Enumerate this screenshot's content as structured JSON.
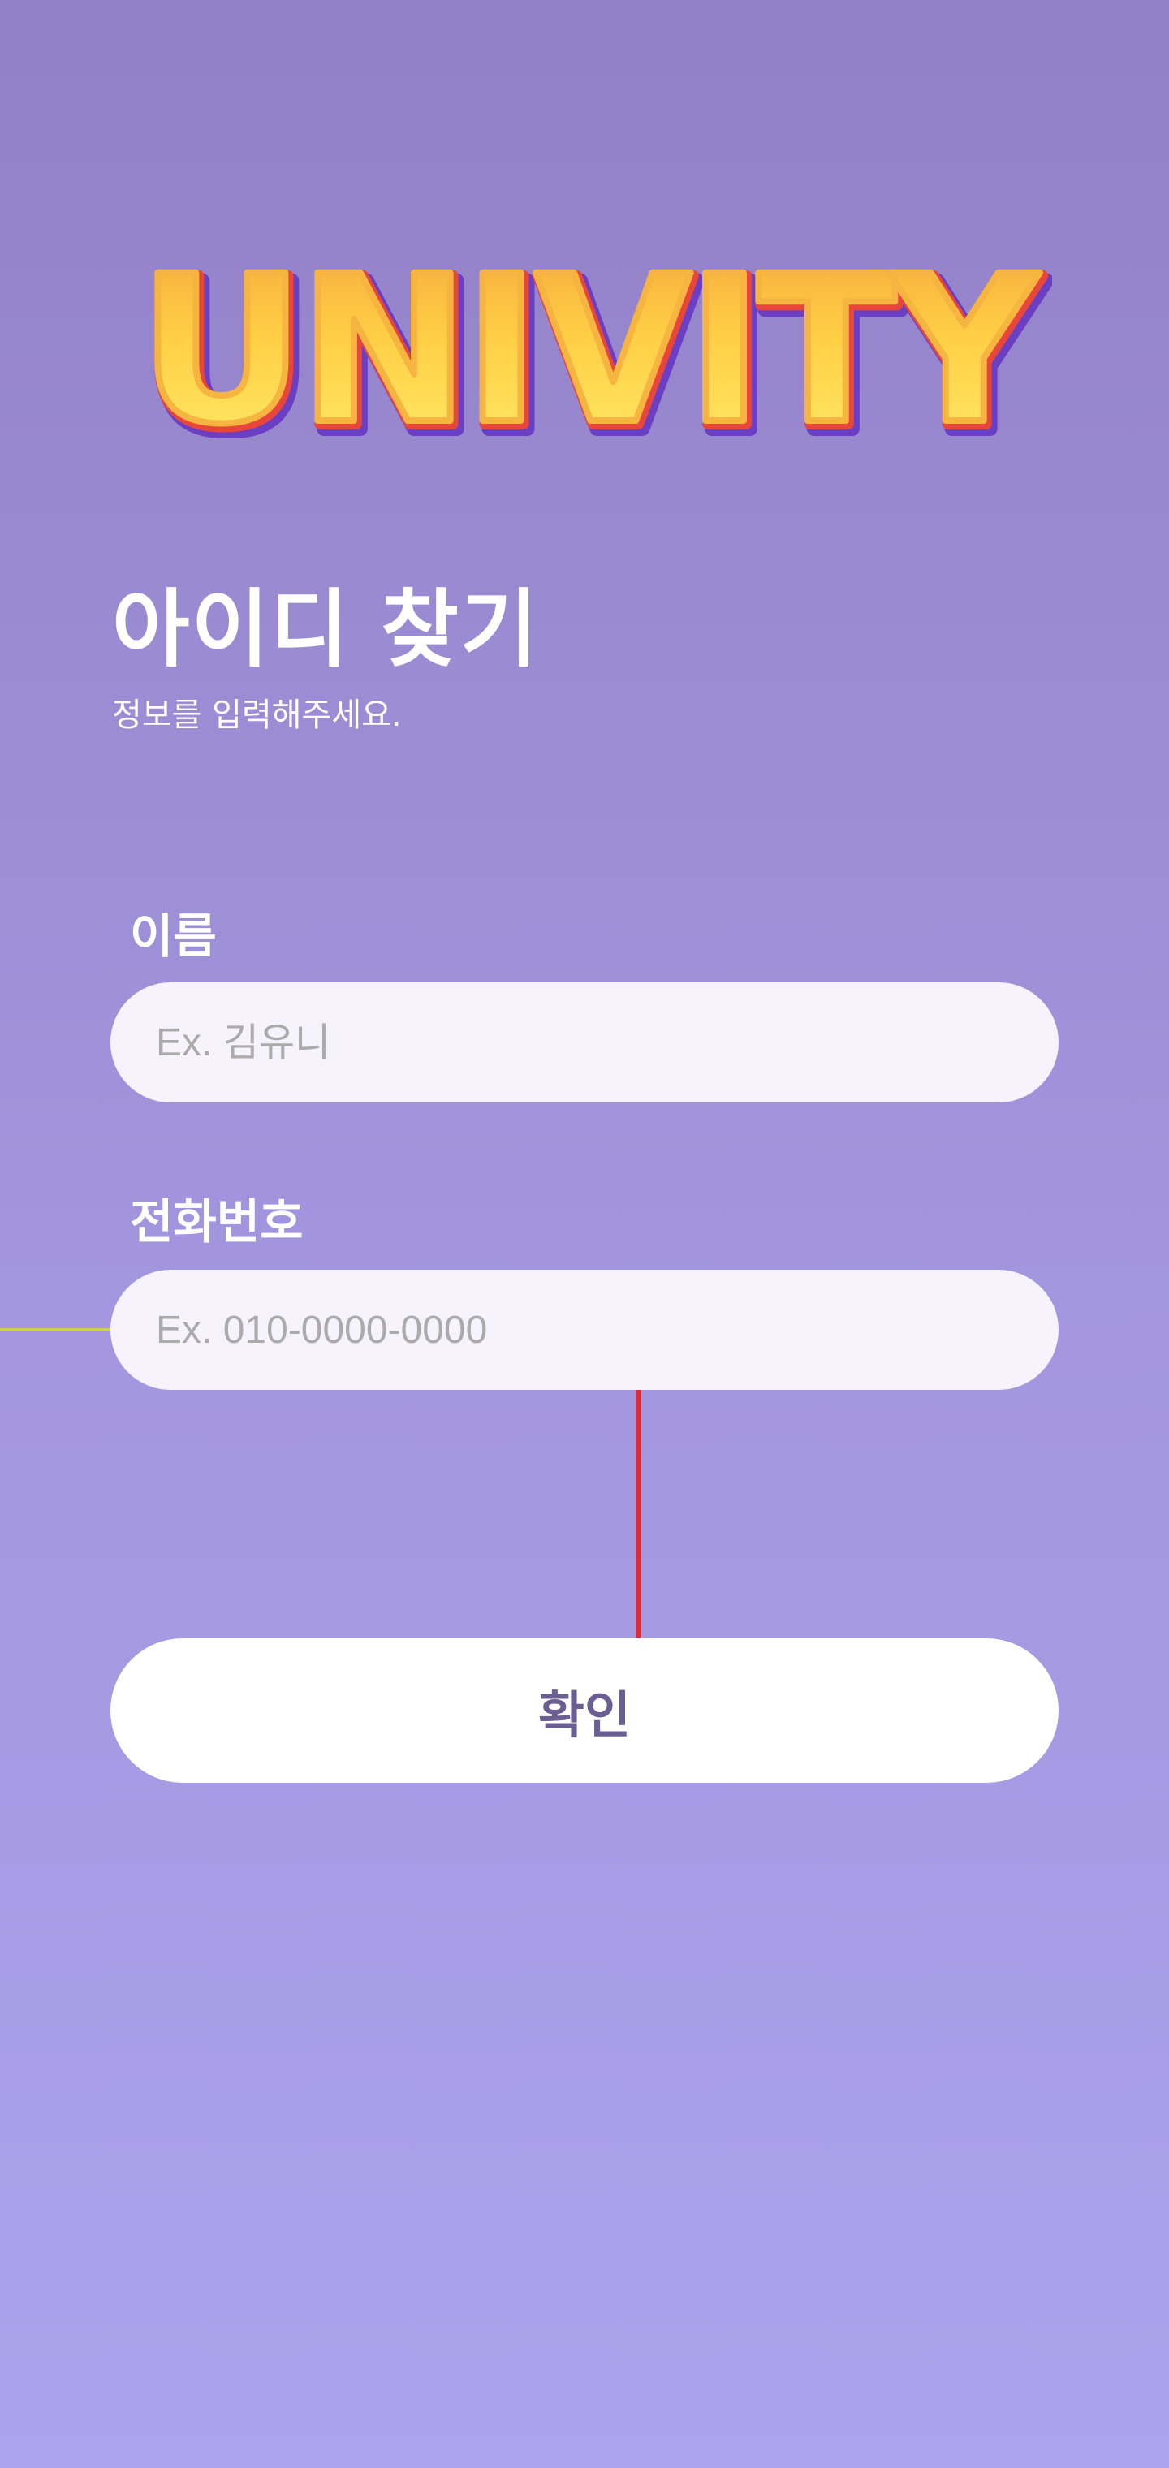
{
  "app": {
    "logo_text": "UNIVITY"
  },
  "header": {
    "title": "아이디 찾기",
    "subtitle": "정보를 입력해주세요."
  },
  "form": {
    "name": {
      "label": "이름",
      "placeholder": "Ex. 김유니",
      "value": ""
    },
    "phone": {
      "label": "전화번호",
      "placeholder": "Ex. 010-0000-0000",
      "value": ""
    },
    "confirm_label": "확인"
  },
  "colors": {
    "background_top": "#9280c6",
    "background_bottom": "#aca3ec",
    "input_background": "#f7f3fd",
    "button_text": "#6a5e93",
    "logo_yellow": "#ffd84a",
    "logo_orange": "#f2a23a"
  }
}
